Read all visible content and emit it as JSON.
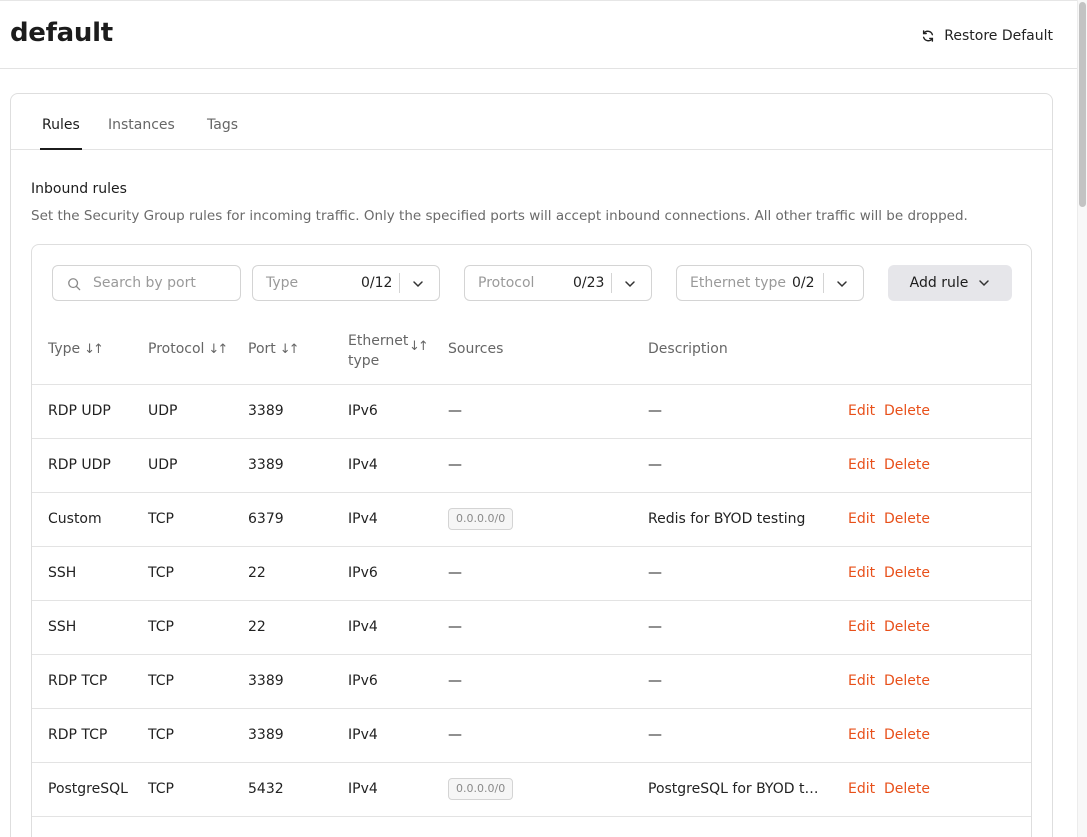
{
  "header": {
    "title": "default",
    "restore_label": "Restore Default"
  },
  "tabs": [
    {
      "label": "Rules",
      "active": true
    },
    {
      "label": "Instances",
      "active": false
    },
    {
      "label": "Tags",
      "active": false
    }
  ],
  "inbound": {
    "title": "Inbound rules",
    "description": "Set the Security Group rules for incoming traffic. Only the specified ports will accept inbound connections. All other traffic will be dropped."
  },
  "filters": {
    "search_placeholder": "Search by port",
    "type": {
      "label": "Type",
      "count": "0/12"
    },
    "protocol": {
      "label": "Protocol",
      "count": "0/23"
    },
    "ethernet": {
      "label": "Ethernet type",
      "count": "0/2"
    },
    "add_rule_label": "Add rule"
  },
  "columns": {
    "type": "Type",
    "protocol": "Protocol",
    "port": "Port",
    "ethernet_line1": "Ethernet",
    "ethernet_line2": "type",
    "sources": "Sources",
    "description": "Description",
    "sort_glyph": "↓↑"
  },
  "actions": {
    "edit": "Edit",
    "delete": "Delete"
  },
  "rows": [
    {
      "type": "RDP UDP",
      "protocol": "UDP",
      "port": "3389",
      "ethernet": "IPv6",
      "sources": "—",
      "sources_badge": false,
      "description": "—"
    },
    {
      "type": "RDP UDP",
      "protocol": "UDP",
      "port": "3389",
      "ethernet": "IPv4",
      "sources": "—",
      "sources_badge": false,
      "description": "—"
    },
    {
      "type": "Custom",
      "protocol": "TCP",
      "port": "6379",
      "ethernet": "IPv4",
      "sources": "0.0.0.0/0",
      "sources_badge": true,
      "description": "Redis for BYOD testing"
    },
    {
      "type": "SSH",
      "protocol": "TCP",
      "port": "22",
      "ethernet": "IPv6",
      "sources": "—",
      "sources_badge": false,
      "description": "—"
    },
    {
      "type": "SSH",
      "protocol": "TCP",
      "port": "22",
      "ethernet": "IPv4",
      "sources": "—",
      "sources_badge": false,
      "description": "—"
    },
    {
      "type": "RDP TCP",
      "protocol": "TCP",
      "port": "3389",
      "ethernet": "IPv6",
      "sources": "—",
      "sources_badge": false,
      "description": "—"
    },
    {
      "type": "RDP TCP",
      "protocol": "TCP",
      "port": "3389",
      "ethernet": "IPv4",
      "sources": "—",
      "sources_badge": false,
      "description": "—"
    },
    {
      "type": "PostgreSQL",
      "protocol": "TCP",
      "port": "5432",
      "ethernet": "IPv4",
      "sources": "0.0.0.0/0",
      "sources_badge": true,
      "description": "PostgreSQL for BYOD t…"
    }
  ],
  "colors": {
    "accent": "#e8501a",
    "text": "#222222",
    "muted": "#666666"
  }
}
